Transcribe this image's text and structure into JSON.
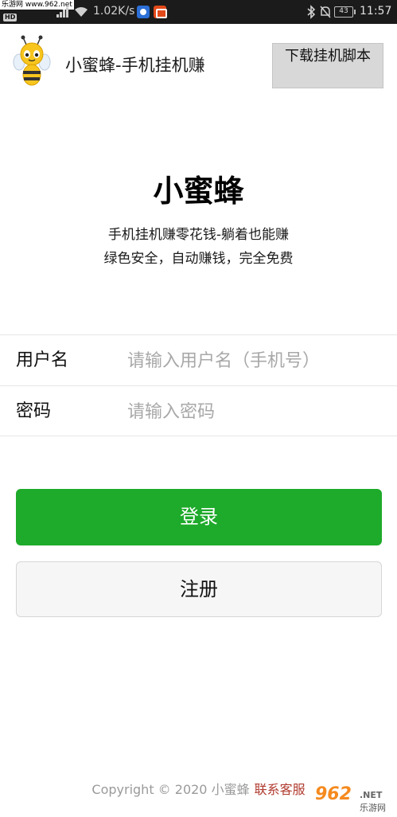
{
  "status_bar": {
    "watermark": "乐游网 www.962.net",
    "hd": "HD",
    "net_speed": "1.02K/s",
    "battery": "43",
    "time": "11:57"
  },
  "header": {
    "app_title": "小蜜蜂-手机挂机赚",
    "download_button": "下载挂机脚本"
  },
  "brand": {
    "title": "小蜜蜂",
    "subtitle_line1": "手机挂机赚零花钱-躺着也能赚",
    "subtitle_line2": "绿色安全，自动赚钱，完全免费"
  },
  "form": {
    "username_label": "用户名",
    "username_placeholder": "请输入用户名（手机号）",
    "password_label": "密码",
    "password_placeholder": "请输入密码"
  },
  "actions": {
    "login": "登录",
    "register": "注册"
  },
  "footer": {
    "copyright": "Copyright © 2020 小蜜蜂",
    "contact": "联系客服"
  },
  "watermark_br": {
    "big": "962",
    "net": ".NET",
    "cn": "乐游网"
  },
  "colors": {
    "login_green": "#1eaa2a",
    "contact_red": "#b03a2e",
    "status_bar_bg": "#1b1b1b"
  }
}
